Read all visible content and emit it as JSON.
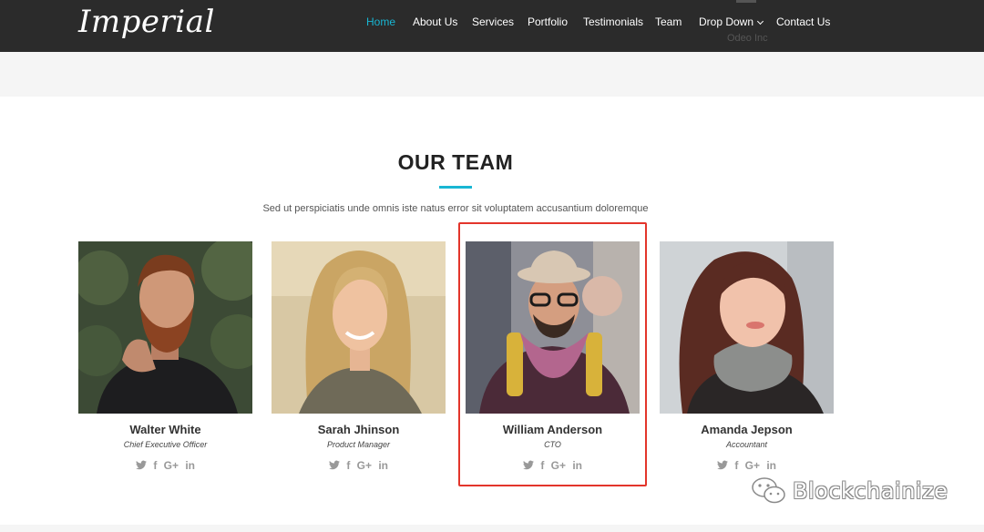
{
  "header": {
    "logo": "Imperial",
    "nav": [
      {
        "label": "Home",
        "active": true
      },
      {
        "label": "About Us"
      },
      {
        "label": "Services"
      },
      {
        "label": "Portfolio"
      },
      {
        "label": "Testimonials"
      },
      {
        "label": "Team"
      },
      {
        "label": "Drop Down",
        "has_dropdown": true
      },
      {
        "label": "Contact Us"
      }
    ],
    "dropdown_ghost_text": "Odeo Inc"
  },
  "team": {
    "title": "OUR TEAM",
    "subtitle": "Sed ut perspiciatis unde omnis iste natus error sit voluptatem accusantium doloremque",
    "members": [
      {
        "name": "Walter White",
        "role": "Chief Executive Officer"
      },
      {
        "name": "Sarah Jhinson",
        "role": "Product Manager"
      },
      {
        "name": "William Anderson",
        "role": "CTO"
      },
      {
        "name": "Amanda Jepson",
        "role": "Accountant"
      }
    ],
    "social": {
      "facebook": "f",
      "googleplus": "G+",
      "linkedin": "in"
    }
  },
  "watermark": "Blockchainize",
  "colors": {
    "accent": "#18b6d3",
    "header_bg": "#2b2b2b",
    "highlight": "#e3352b"
  }
}
